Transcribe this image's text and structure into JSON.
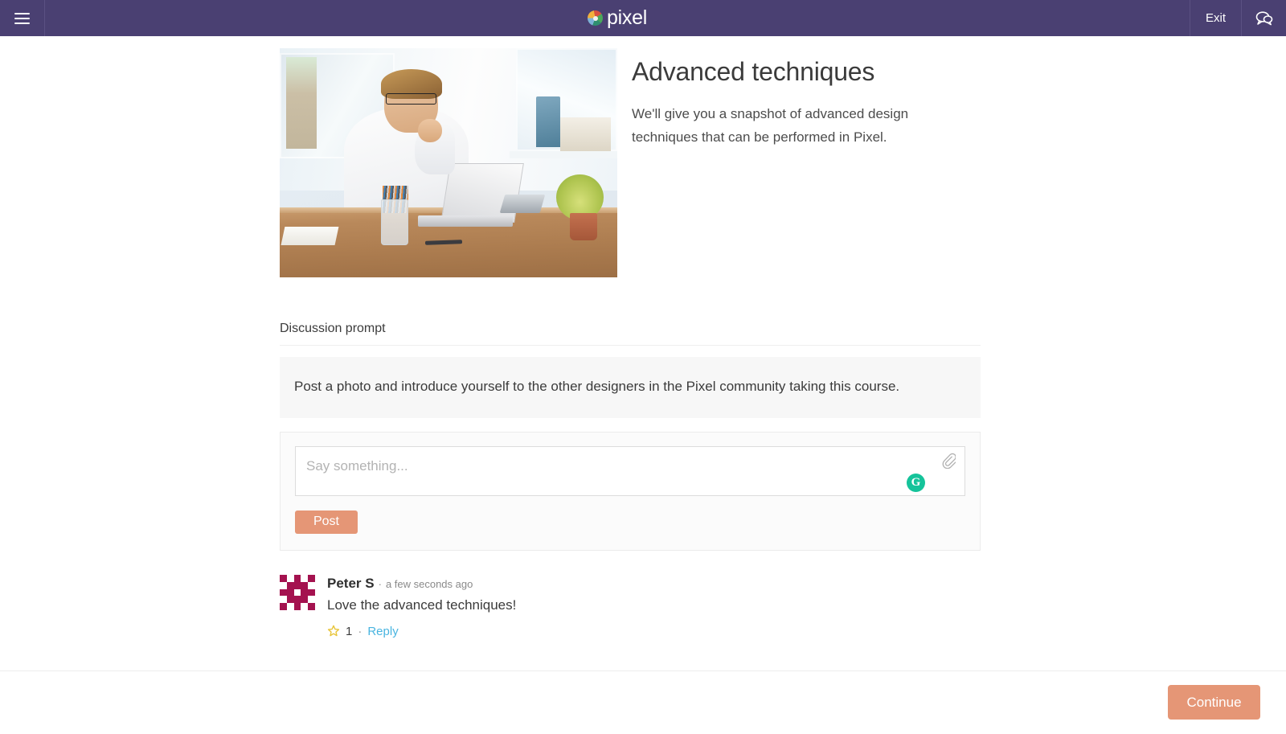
{
  "topbar": {
    "menu_icon": "hamburger-menu-icon",
    "logo_text": "pixel",
    "logo_icon": "pixel-logo-mark",
    "exit_label": "Exit",
    "chat_icon": "chat-bubble-icon",
    "bar_color": "#4a4072"
  },
  "hero": {
    "photo_alt": "man with glasses working on laptop at desk",
    "title": "Advanced techniques",
    "description": "We'll give you a snapshot of advanced design techniques that can be performed in Pixel."
  },
  "discussion": {
    "section_label": "Discussion prompt",
    "prompt_text": "Post a photo and introduce yourself to the other designers in the Pixel community taking this course."
  },
  "composer": {
    "placeholder": "Say something...",
    "value": "",
    "attach_icon": "paperclip-icon",
    "grammarly_icon": "grammarly-badge-icon",
    "grammarly_letter": "G",
    "post_label": "Post",
    "post_color": "#e59676"
  },
  "comment": {
    "avatar_alt": "identicon-avatar",
    "avatar_color": "#a4124f",
    "author": "Peter S",
    "separator": "·",
    "timestamp": "a few seconds ago",
    "body": "Love the advanced techniques!",
    "star_icon": "star-outline-icon",
    "star_count": "1",
    "action_dot": "·",
    "reply_label": "Reply",
    "reply_color": "#49b5e0"
  },
  "footer": {
    "continue_label": "Continue",
    "continue_color": "#e59676"
  }
}
